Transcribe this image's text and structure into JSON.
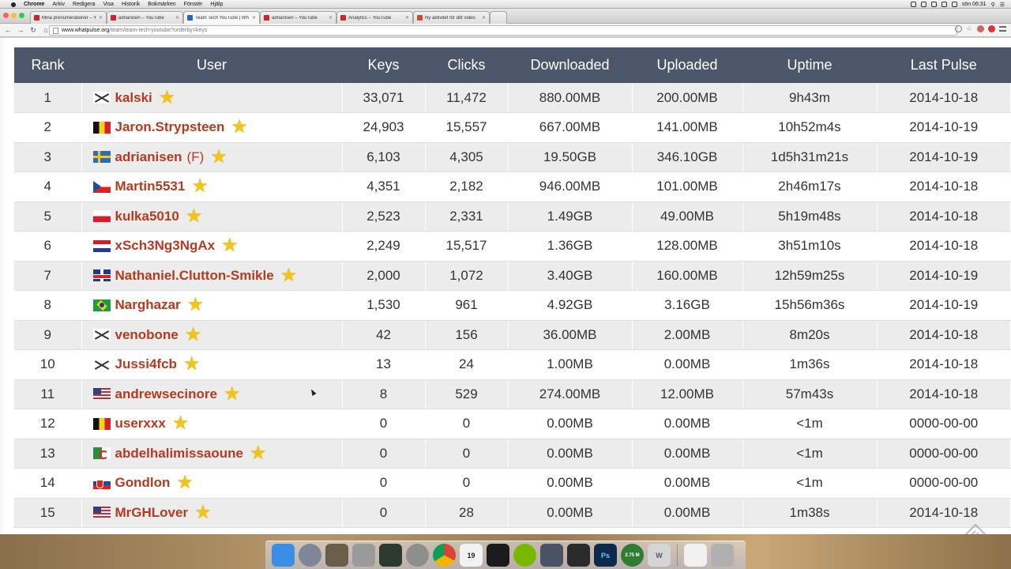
{
  "menubar": {
    "app": "Chrome",
    "items": [
      "Arkiv",
      "Redigera",
      "Visa",
      "Historik",
      "Bokmärken",
      "Fönster",
      "Hjälp"
    ],
    "clock": "sön 06:31"
  },
  "tabs": [
    {
      "title": "Mina prenumerationer – Yo",
      "fav_color": "#d32323"
    },
    {
      "title": "adrianisen – YouTube",
      "fav_color": "#d32323"
    },
    {
      "title": "Team Tech YouTube | Wh",
      "fav_color": "#2a62c9"
    },
    {
      "title": "adrianisen – YouTube",
      "fav_color": "#d32323"
    },
    {
      "title": "Analytics – YouTube",
      "fav_color": "#d32323"
    },
    {
      "title": "Ny aktivitet för ditt video",
      "fav_color": "#d44638"
    }
  ],
  "address": {
    "domain": "www.whatpulse.org",
    "path": "/team/team-tech-youtube?orderby=keys"
  },
  "table": {
    "headers": {
      "rank": "Rank",
      "user": "User",
      "keys": "Keys",
      "clicks": "Clicks",
      "downloaded": "Downloaded",
      "uploaded": "Uploaded",
      "uptime": "Uptime",
      "last_pulse": "Last Pulse"
    },
    "rows": [
      {
        "rank": "1",
        "flag": "none",
        "user": "kalski",
        "tag": "",
        "keys": "33,071",
        "clicks": "11,472",
        "downloaded": "880.00MB",
        "uploaded": "200.00MB",
        "uptime": "9h43m",
        "last_pulse": "2014-10-18"
      },
      {
        "rank": "2",
        "flag": "be",
        "user": "Jaron.Strypsteen",
        "tag": "",
        "keys": "24,903",
        "clicks": "15,557",
        "downloaded": "667.00MB",
        "uploaded": "141.00MB",
        "uptime": "10h52m4s",
        "last_pulse": "2014-10-19"
      },
      {
        "rank": "3",
        "flag": "se",
        "user": "adrianisen",
        "tag": "(F)",
        "keys": "6,103",
        "clicks": "4,305",
        "downloaded": "19.50GB",
        "uploaded": "346.10GB",
        "uptime": "1d5h31m21s",
        "last_pulse": "2014-10-19"
      },
      {
        "rank": "4",
        "flag": "cz",
        "user": "Martin5531",
        "tag": "",
        "keys": "4,351",
        "clicks": "2,182",
        "downloaded": "946.00MB",
        "uploaded": "101.00MB",
        "uptime": "2h46m17s",
        "last_pulse": "2014-10-18"
      },
      {
        "rank": "5",
        "flag": "pl",
        "user": "kulka5010",
        "tag": "",
        "keys": "2,523",
        "clicks": "2,331",
        "downloaded": "1.49GB",
        "uploaded": "49.00MB",
        "uptime": "5h19m48s",
        "last_pulse": "2014-10-18"
      },
      {
        "rank": "6",
        "flag": "nl",
        "user": "xSch3Ng3NgAx",
        "tag": "",
        "keys": "2,249",
        "clicks": "15,517",
        "downloaded": "1.36GB",
        "uploaded": "128.00MB",
        "uptime": "3h51m10s",
        "last_pulse": "2014-10-18"
      },
      {
        "rank": "7",
        "flag": "gb",
        "user": "Nathaniel.Clutton-Smikle",
        "tag": "",
        "keys": "2,000",
        "clicks": "1,072",
        "downloaded": "3.40GB",
        "uploaded": "160.00MB",
        "uptime": "12h59m25s",
        "last_pulse": "2014-10-19"
      },
      {
        "rank": "8",
        "flag": "br",
        "user": "Narghazar",
        "tag": "",
        "keys": "1,530",
        "clicks": "961",
        "downloaded": "4.92GB",
        "uploaded": "3.16GB",
        "uptime": "15h56m36s",
        "last_pulse": "2014-10-19"
      },
      {
        "rank": "9",
        "flag": "none",
        "user": "venobone",
        "tag": "",
        "keys": "42",
        "clicks": "156",
        "downloaded": "36.00MB",
        "uploaded": "2.00MB",
        "uptime": "8m20s",
        "last_pulse": "2014-10-18"
      },
      {
        "rank": "10",
        "flag": "none",
        "user": "Jussi4fcb",
        "tag": "",
        "keys": "13",
        "clicks": "24",
        "downloaded": "1.00MB",
        "uploaded": "0.00MB",
        "uptime": "1m36s",
        "last_pulse": "2014-10-18"
      },
      {
        "rank": "11",
        "flag": "us",
        "user": "andrewsecinore",
        "tag": "",
        "keys": "8",
        "clicks": "529",
        "downloaded": "274.00MB",
        "uploaded": "12.00MB",
        "uptime": "57m43s",
        "last_pulse": "2014-10-18"
      },
      {
        "rank": "12",
        "flag": "be",
        "user": "userxxx",
        "tag": "",
        "keys": "0",
        "clicks": "0",
        "downloaded": "0.00MB",
        "uploaded": "0.00MB",
        "uptime": "<1m",
        "last_pulse": "0000-00-00"
      },
      {
        "rank": "13",
        "flag": "dz",
        "user": "abdelhalimissaoune",
        "tag": "",
        "keys": "0",
        "clicks": "0",
        "downloaded": "0.00MB",
        "uploaded": "0.00MB",
        "uptime": "<1m",
        "last_pulse": "0000-00-00"
      },
      {
        "rank": "14",
        "flag": "sk",
        "user": "Gondlon",
        "tag": "",
        "keys": "0",
        "clicks": "0",
        "downloaded": "0.00MB",
        "uploaded": "0.00MB",
        "uptime": "<1m",
        "last_pulse": "0000-00-00"
      },
      {
        "rank": "15",
        "flag": "us",
        "user": "MrGHLover",
        "tag": "",
        "keys": "0",
        "clicks": "28",
        "downloaded": "0.00MB",
        "uploaded": "0.00MB",
        "uptime": "1m38s",
        "last_pulse": "2014-10-18"
      }
    ]
  },
  "dock": {
    "items": [
      {
        "name": "finder-icon",
        "color": "#3a8ee6"
      },
      {
        "name": "launchpad-icon",
        "color": "#7d8796"
      },
      {
        "name": "photo-app-icon",
        "color": "#6a5d4a"
      },
      {
        "name": "calculator-icon",
        "color": "#9a9a9a"
      },
      {
        "name": "activity-monitor-icon",
        "color": "#2b3b2e"
      },
      {
        "name": "system-preferences-icon",
        "color": "#8e8e8e"
      },
      {
        "name": "chrome-icon",
        "color": "#e0b02a"
      },
      {
        "name": "calendar-icon",
        "color": "#f2f2f2",
        "label": "19"
      },
      {
        "name": "terminal-icon",
        "color": "#1b1b1b"
      },
      {
        "name": "spotify-icon",
        "color": "#7ab800"
      },
      {
        "name": "imovie-icon",
        "color": "#4a5366"
      },
      {
        "name": "final-cut-icon",
        "color": "#2b2b2b"
      },
      {
        "name": "photoshop-icon",
        "color": "#0b2a4d",
        "label": "Ps"
      },
      {
        "name": "network-monitor-icon",
        "color": "#2e7d32",
        "label": "2.75 M"
      },
      {
        "name": "word-icon",
        "color": "#d5d5d5",
        "label": "W"
      },
      {
        "name": "document-icon",
        "color": "#f0f0f0"
      },
      {
        "name": "trash-icon",
        "color": "#b0b0b0"
      }
    ]
  },
  "colors": {
    "header_bg": "#4c566a",
    "username": "#b63a1f",
    "star": "#f0c419"
  }
}
